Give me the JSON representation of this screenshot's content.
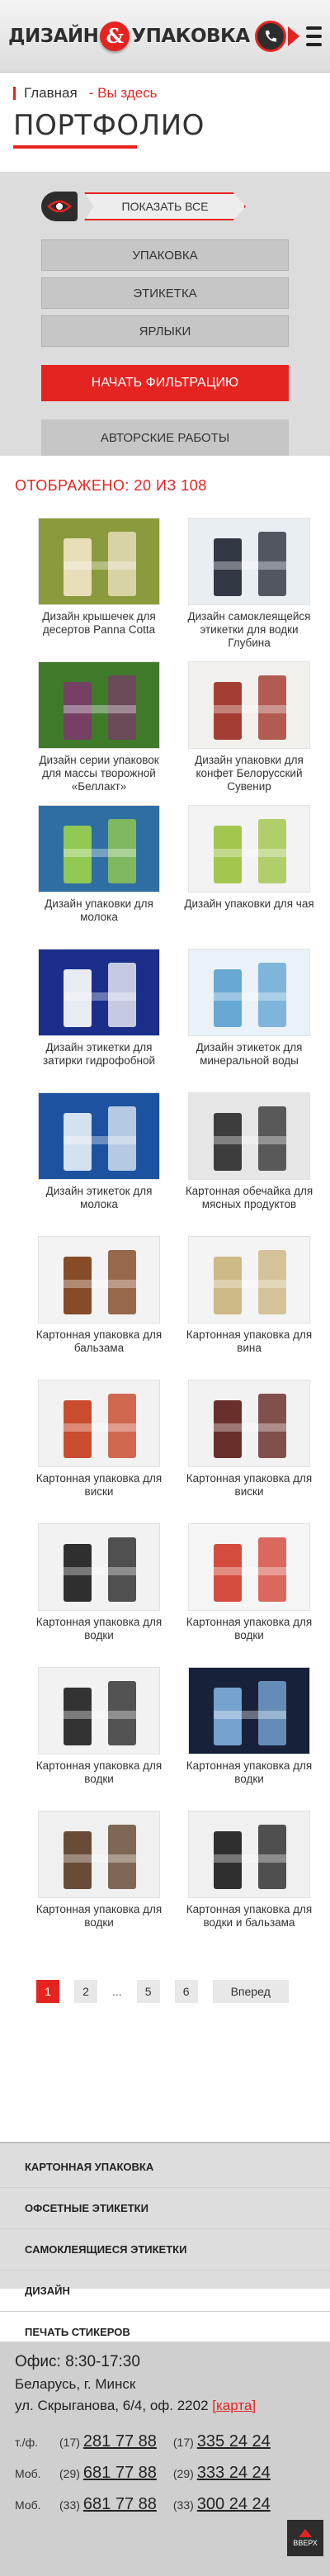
{
  "header": {
    "logo_word1": "ДИЗАЙН",
    "logo_amp": "&",
    "logo_word2": "УПАКОВКА",
    "accent": "#e52421"
  },
  "breadcrumb": {
    "home": "Главная",
    "here": "Вы здесь"
  },
  "page_title": "ПОРТФОЛИО",
  "filter": {
    "show_all": "ПОКАЗАТЬ ВСЕ",
    "categories": [
      "УПАКОВКА",
      "ЭТИКЕТКА",
      "ЯРЛЫКИ"
    ],
    "apply": "НАЧАТЬ ФИЛЬТРАЦИЮ",
    "author": "АВТОРСКИЕ РАБОТЫ"
  },
  "shown_count": "ОТОБРАЖЕНО: 20 ИЗ 108",
  "items": [
    {
      "caption": "Дизайн крышечек для десертов Panna Cotta",
      "bg": "#8a9a3c",
      "fg": "#f2e6c8"
    },
    {
      "caption": "Дизайн самоклеящейся этикетки для водки Глубина",
      "bg": "#e9eef2",
      "fg": "#1e2430"
    },
    {
      "caption": "Дизайн серии упаковок для массы творожной «Беллакт»",
      "bg": "#3f7a2b",
      "fg": "#7a3a6a"
    },
    {
      "caption": "Дизайн упаковки для конфет Белорусский Сувенир",
      "bg": "#f2f0ec",
      "fg": "#9c2a1e"
    },
    {
      "caption": "Дизайн упаковки для молока",
      "bg": "#2f6ea3",
      "fg": "#9bd24a"
    },
    {
      "caption": "Дизайн упаковки для чая",
      "bg": "#f3f3f3",
      "fg": "#9ac23c"
    },
    {
      "caption": "Дизайн этикетки для затирки гидрофобной",
      "bg": "#1a2e8a",
      "fg": "#ffffff"
    },
    {
      "caption": "Дизайн этикеток для минеральной воды",
      "bg": "#eaf2f7",
      "fg": "#5aa0d0"
    },
    {
      "caption": "Дизайн этикеток для молока",
      "bg": "#1c52a0",
      "fg": "#e9f1f8"
    },
    {
      "caption": "Картонная обечайка для мясных продуктов",
      "bg": "#e6e6e6",
      "fg": "#2a2a2a"
    },
    {
      "caption": "Картонная упаковка для бальзама",
      "bg": "#f3f3f3",
      "fg": "#7a3a12"
    },
    {
      "caption": "Картонная упаковка для вина",
      "bg": "#f4f4f4",
      "fg": "#c9b37a"
    },
    {
      "caption": "Картонная упаковка для виски",
      "bg": "#f2f2f2",
      "fg": "#c43a1a"
    },
    {
      "caption": "Картонная упаковка для виски",
      "bg": "#f2f2f2",
      "fg": "#5a1a14"
    },
    {
      "caption": "Картонная упаковка для водки",
      "bg": "#f2f2f2",
      "fg": "#1a1a1a"
    },
    {
      "caption": "Картонная упаковка для водки",
      "bg": "#f5f5f5",
      "fg": "#d03a2a"
    },
    {
      "caption": "Картонная упаковка для водки",
      "bg": "#f2f2f2",
      "fg": "#1e1e1e"
    },
    {
      "caption": "Картонная упаковка для водки",
      "bg": "#17213a",
      "fg": "#7fb0e0"
    },
    {
      "caption": "Картонная упаковка для водки",
      "bg": "#f0f0f0",
      "fg": "#5a3a22"
    },
    {
      "caption": "Картонная упаковка для водки и бальзама",
      "bg": "#f0f0f0",
      "fg": "#1a1a1a"
    }
  ],
  "pagination": {
    "pages": [
      "1",
      "2",
      "5",
      "6"
    ],
    "ellipsis": "...",
    "next": "Вперед"
  },
  "footer_nav": [
    "КАРТОННАЯ УПАКОВКА",
    "ОФСЕТНЫЕ ЭТИКЕТКИ",
    "САМОКЛЕЯЩИЕСЯ ЭТИКЕТКИ",
    "ДИЗАЙН",
    "ПЕЧАТЬ СТИКЕРОВ"
  ],
  "contacts": {
    "hours": "Офис: 8:30-17:30",
    "city": "Беларусь, г. Минск",
    "address": "ул. Скрыганова, 6/4, оф. 2202",
    "map": "[карта]",
    "phones": [
      {
        "type": "т./ф.",
        "code1": "(17)",
        "num1": "281 77 88",
        "code2": "(17)",
        "num2": "335 24 24"
      },
      {
        "type": "Моб.",
        "code1": "(29)",
        "num1": "681 77 88",
        "code2": "(29)",
        "num2": "333 24 24"
      },
      {
        "type": "Моб.",
        "code1": "(33)",
        "num1": "681 77 88",
        "code2": "(33)",
        "num2": "300 24 24"
      }
    ],
    "up_label": "ВВЕРХ"
  }
}
